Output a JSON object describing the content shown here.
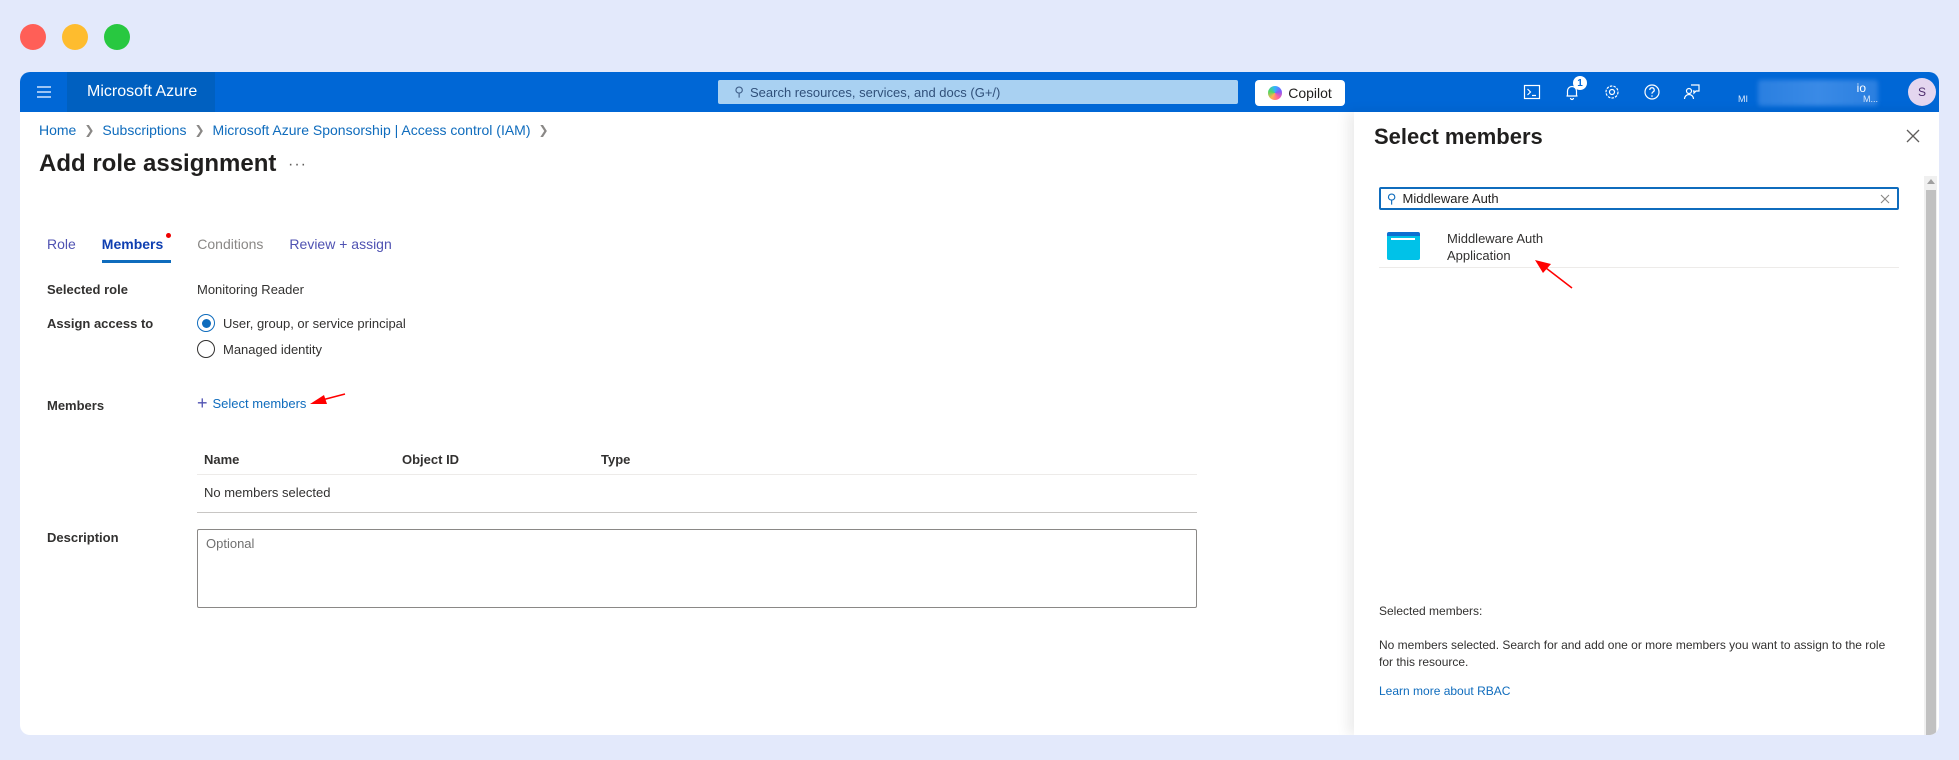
{
  "window_controls": [
    "close",
    "minimize",
    "maximize"
  ],
  "topbar": {
    "brand": "Microsoft Azure",
    "search_placeholder": "Search resources, services, and docs (G+/)",
    "copilot_label": "Copilot",
    "notification_count": "1",
    "account_line1_visible": "io",
    "account_line2_start": "MI",
    "account_line2_end": "M...",
    "avatar_initial": "S",
    "colors": {
      "bar": "#0067d6",
      "brand_bg": "#0060c0"
    }
  },
  "breadcrumb": [
    {
      "label": "Home"
    },
    {
      "label": "Subscriptions"
    },
    {
      "label": "Microsoft Azure Sponsorship | Access control (IAM)"
    }
  ],
  "page": {
    "title": "Add role assignment",
    "more_label": "···"
  },
  "tabs": [
    {
      "label": "Role",
      "state": "normal"
    },
    {
      "label": "Members",
      "state": "active",
      "has_indicator": true
    },
    {
      "label": "Conditions",
      "state": "disabled"
    },
    {
      "label": "Review + assign",
      "state": "normal"
    }
  ],
  "form": {
    "selected_role_label": "Selected role",
    "selected_role_value": "Monitoring Reader",
    "assign_access_label": "Assign access to",
    "assign_options": [
      {
        "label": "User, group, or service principal",
        "checked": true
      },
      {
        "label": "Managed identity",
        "checked": false
      }
    ],
    "members_label": "Members",
    "select_members_link": "Select members",
    "members_table": {
      "columns": [
        "Name",
        "Object ID",
        "Type"
      ],
      "empty_text": "No members selected"
    },
    "description_label": "Description",
    "description_placeholder": "Optional",
    "description_value": ""
  },
  "panel": {
    "title": "Select members",
    "search_value": "Middleware Auth",
    "results": [
      {
        "name": "Middleware Auth",
        "type": "Application"
      }
    ],
    "selected_members_label": "Selected members:",
    "no_selection_text": "No members selected. Search for and add one or more members you want to assign to the role for this resource.",
    "learn_more_link": "Learn more about RBAC"
  },
  "annotations": {
    "arrow_color": "#ff0000"
  }
}
